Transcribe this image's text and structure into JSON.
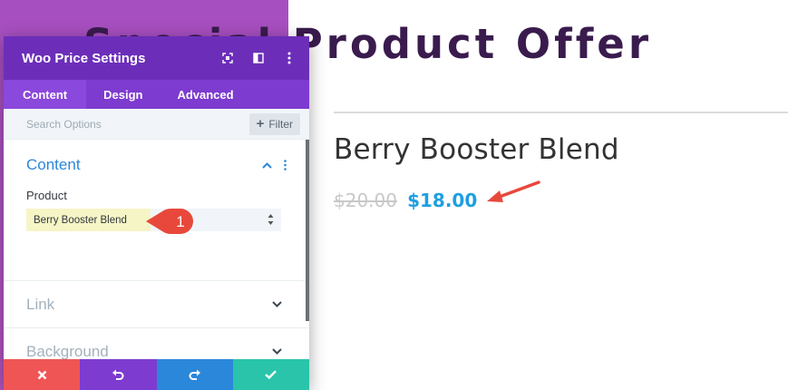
{
  "page": {
    "heading": "Special Product Offer",
    "product_title": "Berry Booster Blend",
    "price_old": "$20.00",
    "price_new": "$18.00"
  },
  "modal": {
    "title": "Woo Price Settings",
    "header_icons": [
      "fullscreen-icon",
      "split-view-icon",
      "more-options-icon"
    ],
    "tabs": [
      {
        "label": "Content",
        "active": true
      },
      {
        "label": "Design",
        "active": false
      },
      {
        "label": "Advanced",
        "active": false
      }
    ],
    "search": {
      "placeholder": "Search Options"
    },
    "filter_label": "Filter",
    "content_section": {
      "title": "Content",
      "product_label": "Product",
      "product_value": "Berry Booster Blend"
    },
    "sections_closed": [
      {
        "title": "Link"
      },
      {
        "title": "Background"
      }
    ],
    "footer_buttons": [
      "discard-icon",
      "undo-icon",
      "redo-icon",
      "save-check-icon"
    ]
  },
  "callout_number": "1",
  "colors": {
    "modal_header": "#6c2eb9",
    "tab_bar": "#7d3bcf",
    "accent_blue": "#2b87da",
    "price_blue": "#1e9fe1",
    "callout_red": "#e8483b",
    "footer_red": "#ef5555",
    "footer_purple": "#7e3bcf",
    "footer_green": "#29c4a9"
  }
}
